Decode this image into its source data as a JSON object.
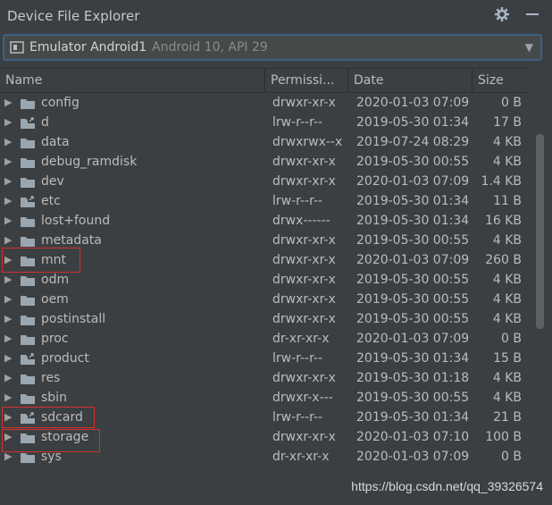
{
  "panel": {
    "title": "Device File Explorer",
    "icons": [
      "gear-icon",
      "minimize-icon"
    ]
  },
  "device": {
    "name": "Emulator Android1",
    "detail": "Android 10, API 29"
  },
  "columns": [
    "Name",
    "Permissi...",
    "Date",
    "Size"
  ],
  "files": [
    {
      "name": "config",
      "perm": "drwxr-xr-x",
      "date": "2020-01-03 07:09",
      "size": "0 B",
      "link": false
    },
    {
      "name": "d",
      "perm": "lrw-r--r--",
      "date": "2019-05-30 01:34",
      "size": "17 B",
      "link": true
    },
    {
      "name": "data",
      "perm": "drwxrwx--x",
      "date": "2019-07-24 08:29",
      "size": "4 KB",
      "link": false
    },
    {
      "name": "debug_ramdisk",
      "perm": "drwxr-xr-x",
      "date": "2019-05-30 00:55",
      "size": "4 KB",
      "link": false
    },
    {
      "name": "dev",
      "perm": "drwxr-xr-x",
      "date": "2020-01-03 07:09",
      "size": "1.4 KB",
      "link": false
    },
    {
      "name": "etc",
      "perm": "lrw-r--r--",
      "date": "2019-05-30 01:34",
      "size": "11 B",
      "link": true
    },
    {
      "name": "lost+found",
      "perm": "drwx------",
      "date": "2019-05-30 01:34",
      "size": "16 KB",
      "link": false
    },
    {
      "name": "metadata",
      "perm": "drwxr-xr-x",
      "date": "2019-05-30 00:55",
      "size": "4 KB",
      "link": false
    },
    {
      "name": "mnt",
      "perm": "drwxr-xr-x",
      "date": "2020-01-03 07:09",
      "size": "260 B",
      "link": false
    },
    {
      "name": "odm",
      "perm": "drwxr-xr-x",
      "date": "2019-05-30 00:55",
      "size": "4 KB",
      "link": false
    },
    {
      "name": "oem",
      "perm": "drwxr-xr-x",
      "date": "2019-05-30 00:55",
      "size": "4 KB",
      "link": false
    },
    {
      "name": "postinstall",
      "perm": "drwxr-xr-x",
      "date": "2019-05-30 00:55",
      "size": "4 KB",
      "link": false
    },
    {
      "name": "proc",
      "perm": "dr-xr-xr-x",
      "date": "2020-01-03 07:09",
      "size": "0 B",
      "link": false
    },
    {
      "name": "product",
      "perm": "lrw-r--r--",
      "date": "2019-05-30 01:34",
      "size": "15 B",
      "link": true
    },
    {
      "name": "res",
      "perm": "drwxr-xr-x",
      "date": "2019-05-30 01:18",
      "size": "4 KB",
      "link": false
    },
    {
      "name": "sbin",
      "perm": "drwxr-x---",
      "date": "2019-05-30 00:55",
      "size": "4 KB",
      "link": false
    },
    {
      "name": "sdcard",
      "perm": "lrw-r--r--",
      "date": "2019-05-30 01:34",
      "size": "21 B",
      "link": true
    },
    {
      "name": "storage",
      "perm": "drwxr-xr-x",
      "date": "2020-01-03 07:10",
      "size": "100 B",
      "link": false
    },
    {
      "name": "sys",
      "perm": "dr-xr-xr-x",
      "date": "2020-01-03 07:09",
      "size": "0 B",
      "link": false
    }
  ],
  "highlight_color": "#d32f2f",
  "watermark": "https://blog.csdn.net/qq_39326574"
}
